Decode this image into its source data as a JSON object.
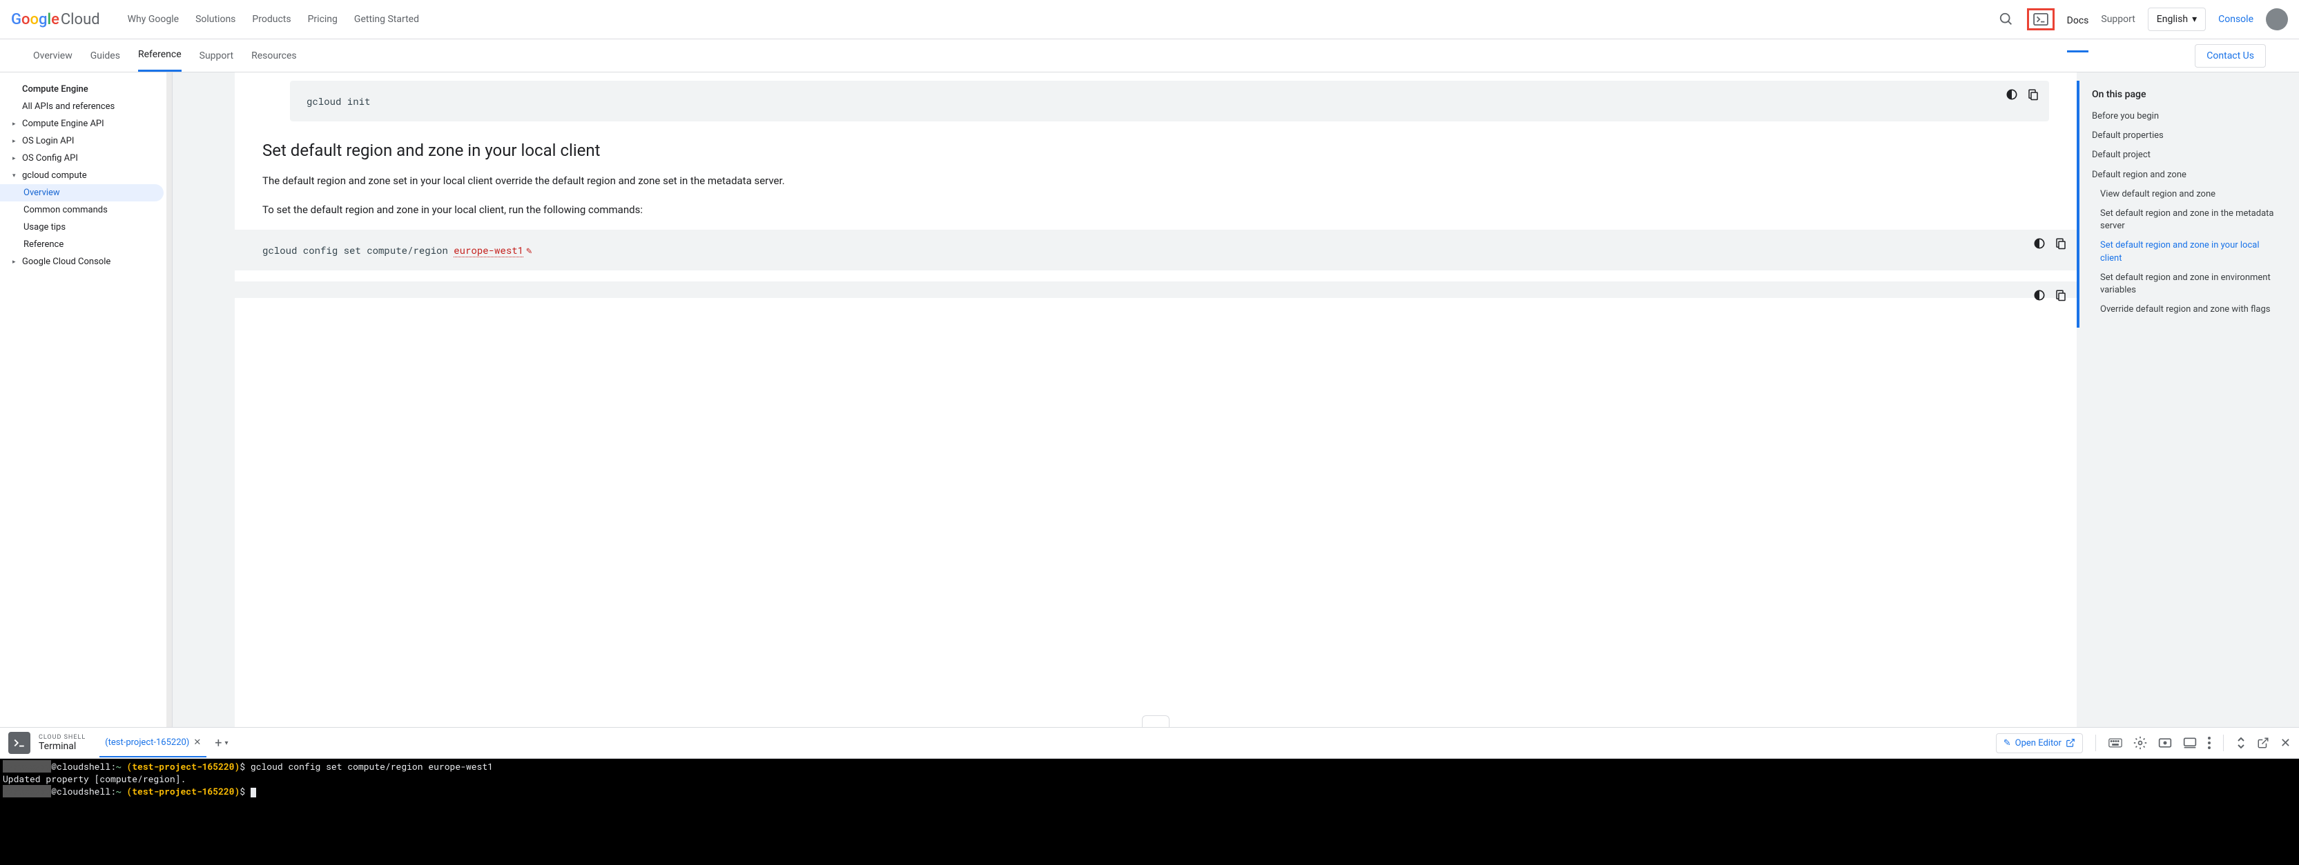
{
  "header": {
    "logo_cloud": "Cloud",
    "nav": [
      "Why Google",
      "Solutions",
      "Products",
      "Pricing",
      "Getting Started"
    ],
    "docs": "Docs",
    "support": "Support",
    "language": "English",
    "console": "Console"
  },
  "subnav": {
    "items": [
      "Overview",
      "Guides",
      "Reference",
      "Support",
      "Resources"
    ],
    "active_index": 2,
    "contact": "Contact Us"
  },
  "sidebar": {
    "items": [
      {
        "label": "Compute Engine",
        "bold": true
      },
      {
        "label": "All APIs and references"
      },
      {
        "label": "Compute Engine API",
        "caret": "▸"
      },
      {
        "label": "OS Login API",
        "caret": "▸"
      },
      {
        "label": "OS Config API",
        "caret": "▸"
      },
      {
        "label": "gcloud compute",
        "caret": "▾"
      },
      {
        "label": "Overview",
        "sub": true,
        "active": true
      },
      {
        "label": "Common commands",
        "sub": true
      },
      {
        "label": "Usage tips",
        "sub": true
      },
      {
        "label": "Reference",
        "sub": true
      },
      {
        "label": "Google Cloud Console",
        "caret": "▸"
      }
    ]
  },
  "content": {
    "code1": "gcloud init",
    "h2": "Set default region and zone in your local client",
    "p1": "The default region and zone set in your local client override the default region and zone set in the metadata server.",
    "p2": "To set the default region and zone in your local client, run the following commands:",
    "code2_prefix": "gcloud config set compute/region ",
    "code2_editable": "europe-west1"
  },
  "toc": {
    "title": "On this page",
    "items": [
      {
        "label": "Before you begin"
      },
      {
        "label": "Default properties"
      },
      {
        "label": "Default project"
      },
      {
        "label": "Default region and zone"
      },
      {
        "label": "View default region and zone",
        "sub": true
      },
      {
        "label": "Set default region and zone in the metadata server",
        "sub": true
      },
      {
        "label": "Set default region and zone in your local client",
        "sub": true,
        "active": true
      },
      {
        "label": "Set default region and zone in environment variables",
        "sub": true
      },
      {
        "label": "Override default region and zone with flags",
        "sub": true
      }
    ]
  },
  "shell": {
    "label": "CLOUD SHELL",
    "terminal_label": "Terminal",
    "tab": "(test-project-165220)",
    "open_editor": "Open Editor",
    "lines": {
      "host": "@cloudshell:",
      "tilde": "~ ",
      "project": "(test-project-165220)",
      "dollar": "$ ",
      "cmd": "gcloud config set compute/region europe-west1",
      "output": "Updated property [compute/region]."
    }
  }
}
